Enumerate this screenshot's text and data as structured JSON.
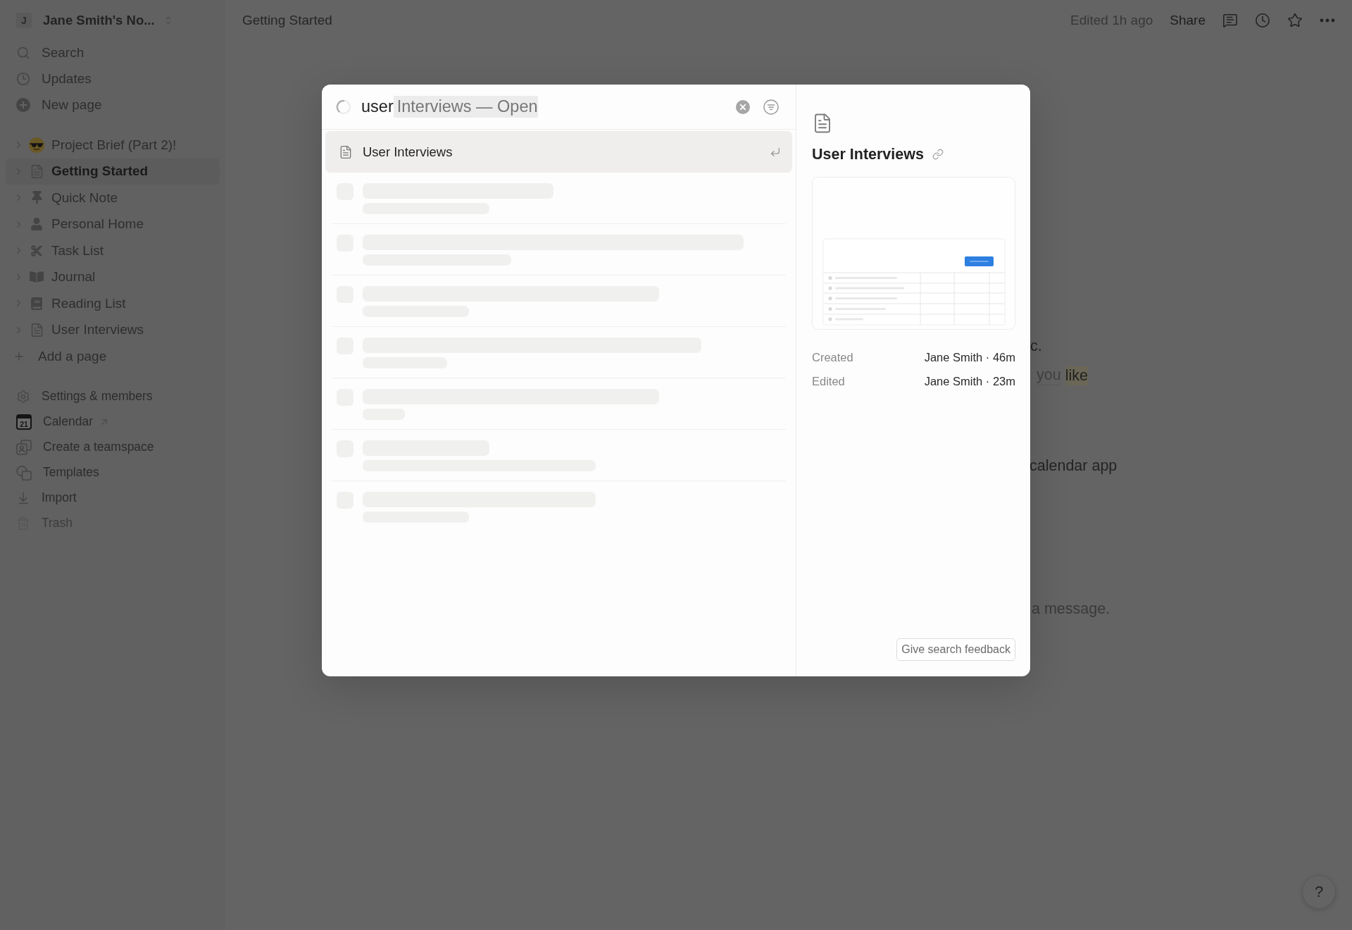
{
  "sidebar": {
    "workspace": {
      "avatar": "J",
      "name": "Jane Smith's No..."
    },
    "nav": [
      {
        "label": "Search"
      },
      {
        "label": "Updates"
      },
      {
        "label": "New page"
      }
    ],
    "pages": [
      {
        "label": "Project Brief (Part 2)!",
        "selected": false
      },
      {
        "label": "Getting Started",
        "selected": true
      },
      {
        "label": "Quick Note",
        "selected": false
      },
      {
        "label": "Personal Home",
        "selected": false
      },
      {
        "label": "Task List",
        "selected": false
      },
      {
        "label": "Journal",
        "selected": false
      },
      {
        "label": "Reading List",
        "selected": false
      },
      {
        "label": "User Interviews",
        "selected": false
      }
    ],
    "add_page": "Add a page",
    "footer": [
      {
        "label": "Settings & members",
        "external": false,
        "muted": false
      },
      {
        "label": "Calendar",
        "date": "21",
        "external": true,
        "muted": false
      },
      {
        "label": "Create a teamspace",
        "external": false,
        "muted": false
      },
      {
        "label": "Templates",
        "external": false,
        "muted": false
      },
      {
        "label": "Import",
        "external": false,
        "muted": false
      },
      {
        "label": "Trash",
        "external": false,
        "muted": true
      }
    ]
  },
  "topbar": {
    "breadcrumb": "Getting Started",
    "edited": "Edited 1h ago",
    "share": "Share"
  },
  "page": {
    "fragments": [
      {
        "spans": [
          {
            "kind": "plain",
            "text": "c."
          }
        ]
      },
      {
        "spans": [
          {
            "kind": "link",
            "text": "you"
          },
          {
            "kind": "highlight",
            "text": "like"
          }
        ]
      },
      {
        "spans": [
          {
            "kind": "plain",
            "text": "calendar app"
          }
        ]
      },
      {
        "spans": [
          {
            "kind": "muted",
            "text": "a message."
          }
        ]
      }
    ]
  },
  "search": {
    "loading": true,
    "query": "user",
    "suggestion": "Interviews — Open",
    "results": [
      {
        "kind": "page",
        "title": "User Interviews",
        "selected": true
      },
      {
        "kind": "skeleton",
        "selected": false
      },
      {
        "kind": "skeleton",
        "selected": false
      },
      {
        "kind": "skeleton",
        "selected": false
      },
      {
        "kind": "skeleton",
        "selected": false
      },
      {
        "kind": "skeleton",
        "selected": false
      },
      {
        "kind": "skeleton",
        "selected": false
      },
      {
        "kind": "skeleton",
        "selected": false
      }
    ]
  },
  "preview": {
    "title": "User Interviews",
    "meta": [
      {
        "label": "Created",
        "value": "Jane Smith · 46m"
      },
      {
        "label": "Edited",
        "value": "Jane Smith · 23m"
      }
    ],
    "feedback": "Give search feedback"
  },
  "help": "?"
}
